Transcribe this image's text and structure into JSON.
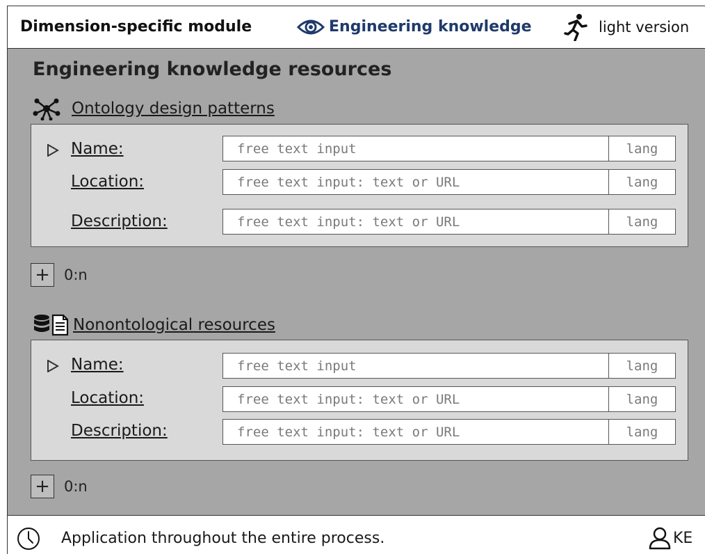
{
  "header": {
    "module_label": "Dimension-specific module",
    "dimension_label": "Engineering knowledge",
    "version_label": "light version"
  },
  "main": {
    "title": "Engineering knowledge resources",
    "sections": [
      {
        "title": "Ontology design patterns",
        "icon": "network-nodes-icon",
        "fields": [
          {
            "label": "Name:",
            "placeholder": "free text input",
            "lang": "lang"
          },
          {
            "label": "Location:",
            "placeholder": "free text input: text or URL",
            "lang": "lang"
          },
          {
            "label": "Description:",
            "placeholder": "free text input: text or URL",
            "lang": "lang"
          }
        ],
        "add_label": "+",
        "cardinality": "0:n"
      },
      {
        "title": "Nonontological resources",
        "icon": "database-document-icon",
        "fields": [
          {
            "label": "Name:",
            "placeholder": "free text input",
            "lang": "lang"
          },
          {
            "label": "Location:",
            "placeholder": "free text input: text or URL",
            "lang": "lang"
          },
          {
            "label": "Description:",
            "placeholder": "free text input: text or URL",
            "lang": "lang"
          }
        ],
        "add_label": "+",
        "cardinality": "0:n"
      }
    ]
  },
  "footer": {
    "timing_text": "Application throughout the entire process.",
    "role": "KE"
  },
  "colors": {
    "panel_bg": "#a6a6a6",
    "subpanel_bg": "#d9d9d9",
    "dimension_accent": "#1f3a6b"
  }
}
